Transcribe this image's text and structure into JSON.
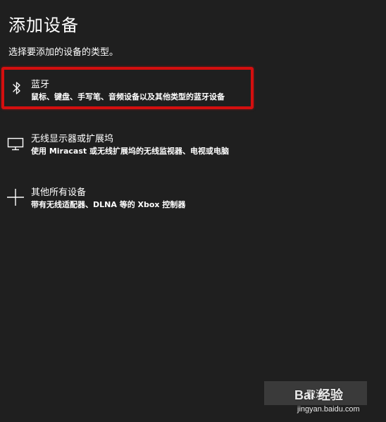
{
  "dialog": {
    "title": "添加设备",
    "subtitle": "选择要添加的设备的类型。"
  },
  "options": [
    {
      "icon": "bluetooth-icon",
      "name": "蓝牙",
      "description": "鼠标、键盘、手写笔、音频设备以及其他类型的蓝牙设备",
      "highlighted": true,
      "highlight_color": "#d40f0f"
    },
    {
      "icon": "monitor-icon",
      "name": "无线显示器或扩展坞",
      "description": "使用 Miracast 或无线扩展坞的无线监视器、电视或电脑"
    },
    {
      "icon": "plus-icon",
      "name": "其他所有设备",
      "description": "带有无线适配器、DLNA 等的 Xbox 控制器"
    }
  ],
  "footer": {
    "cancel_label": "取消"
  },
  "watermark": {
    "logo_text": "Bai 经验",
    "url": "jingyan.baidu.com"
  },
  "colors": {
    "background": "#1f1f1f",
    "text": "#ffffff",
    "button": "#3a3a3a",
    "highlight": "#d40f0f"
  }
}
